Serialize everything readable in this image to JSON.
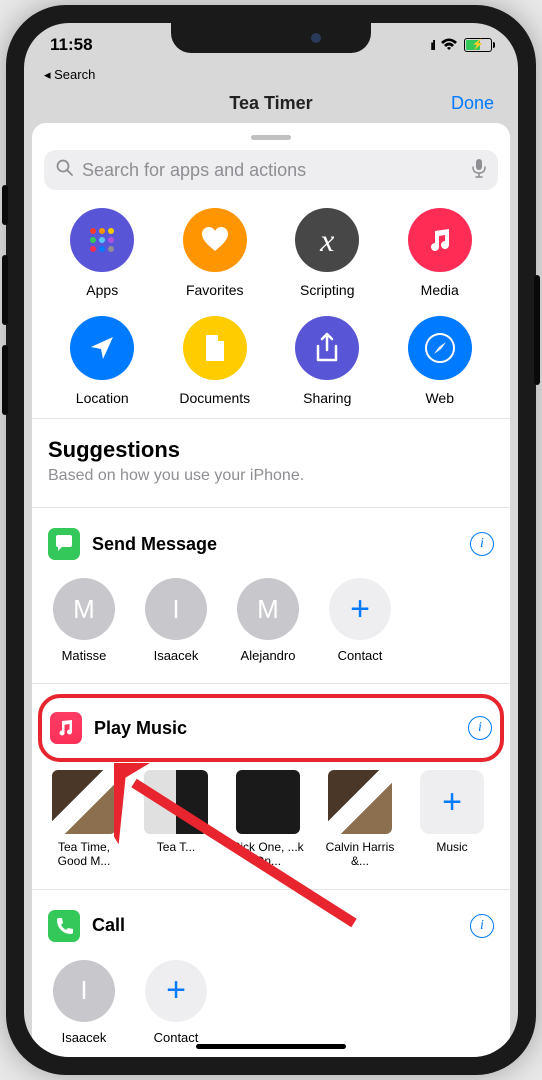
{
  "status": {
    "time": "11:58",
    "signal": "ıl",
    "back_nav": "◂ Search"
  },
  "header": {
    "title": "Tea Timer",
    "done": "Done"
  },
  "search": {
    "placeholder": "Search for apps and actions"
  },
  "categories": [
    {
      "label": "Apps",
      "color": "#5856d6"
    },
    {
      "label": "Favorites",
      "color": "#ff9500"
    },
    {
      "label": "Scripting",
      "color": "#474747"
    },
    {
      "label": "Media",
      "color": "#ff2d55"
    },
    {
      "label": "Location",
      "color": "#007aff"
    },
    {
      "label": "Documents",
      "color": "#ffcc00"
    },
    {
      "label": "Sharing",
      "color": "#5856d6"
    },
    {
      "label": "Web",
      "color": "#007aff"
    }
  ],
  "suggestions": {
    "title": "Suggestions",
    "subtitle": "Based on how you use your iPhone."
  },
  "send_message": {
    "title": "Send Message",
    "icon_color": "#34c759",
    "contacts": [
      {
        "initial": "M",
        "name": "Matisse"
      },
      {
        "initial": "I",
        "name": "Isaacek"
      },
      {
        "initial": "M",
        "name": "Alejandro"
      }
    ],
    "add_label": "Contact"
  },
  "play_music": {
    "title": "Play Music",
    "icon_color": "#fc3158",
    "items": [
      {
        "label": "Tea Time, Good M..."
      },
      {
        "label": "Tea T..."
      },
      {
        "label": "Pick One, ...k On..."
      },
      {
        "label": "Calvin Harris &..."
      }
    ],
    "add_label": "Music"
  },
  "call": {
    "title": "Call",
    "icon_color": "#34c759",
    "contacts": [
      {
        "initial": "I",
        "name": "Isaacek"
      }
    ],
    "add_label": "Contact"
  }
}
